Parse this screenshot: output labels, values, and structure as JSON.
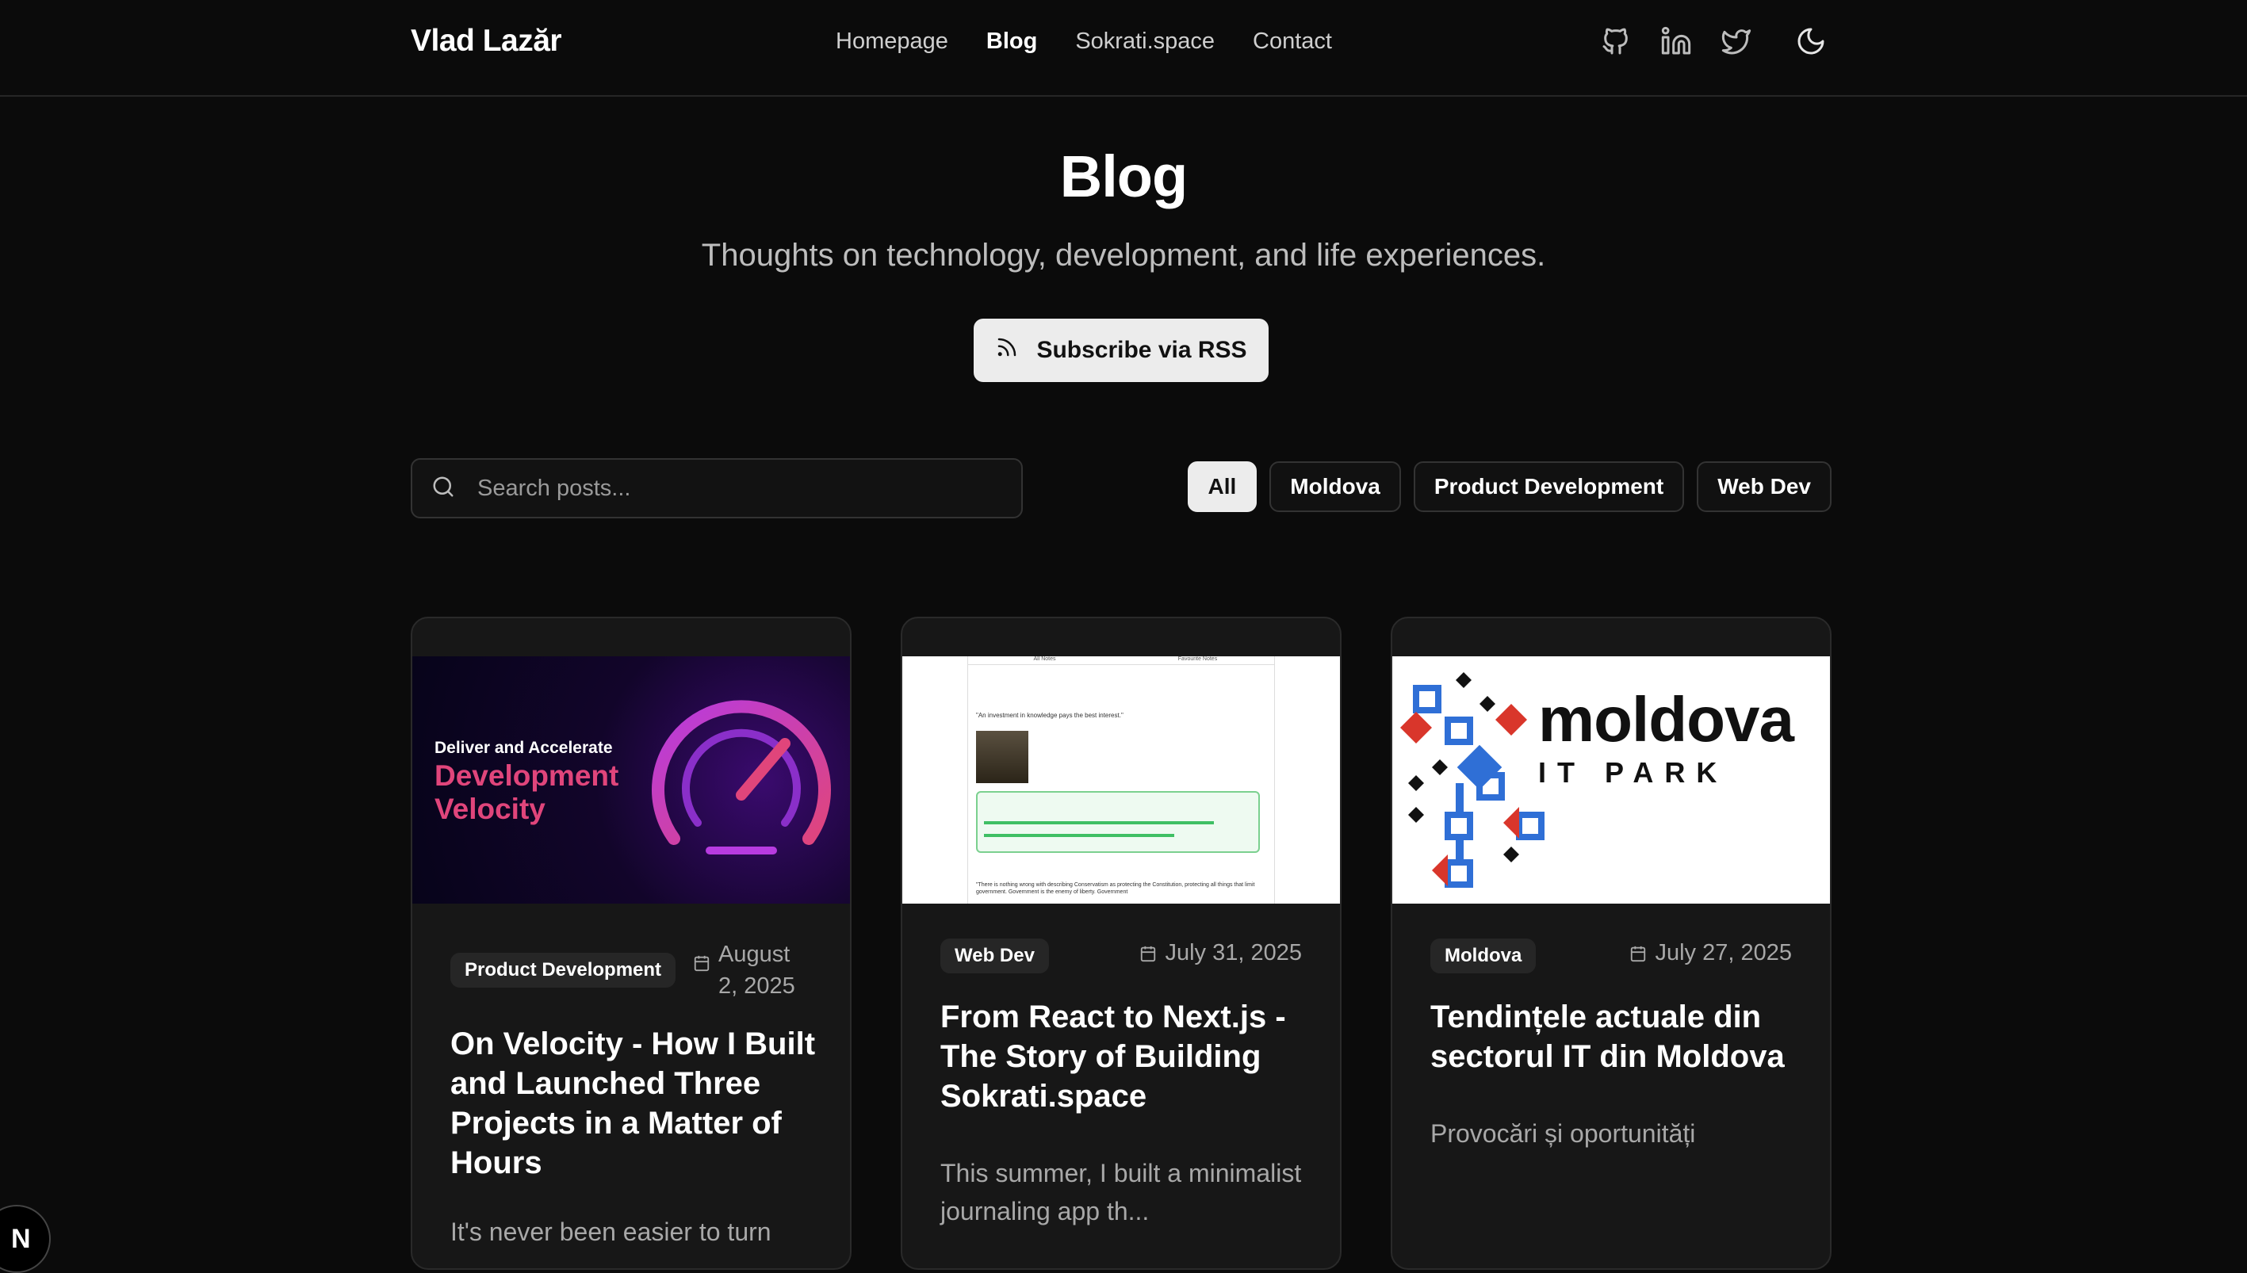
{
  "header": {
    "brand": "Vlad Lazăr",
    "nav": [
      "Homepage",
      "Blog",
      "Sokrati.space",
      "Contact"
    ],
    "active_nav": "Blog",
    "icons": [
      "github-icon",
      "linkedin-icon",
      "twitter-icon",
      "moon-icon"
    ]
  },
  "hero": {
    "title": "Blog",
    "subtitle": "Thoughts on technology, development, and life experiences.",
    "rss_label": "Subscribe via RSS"
  },
  "search": {
    "placeholder": "Search posts..."
  },
  "filters": [
    "All",
    "Moldova",
    "Product Development",
    "Web Dev"
  ],
  "active_filter": "All",
  "posts": [
    {
      "tag": "Product Development",
      "date": "August 2, 2025",
      "title": "On Velocity - How I Built and Launched Three Projects in a Matter of Hours",
      "excerpt": "It's never been easier to turn",
      "thumb": {
        "line1": "Deliver and Accelerate",
        "line2": "Development",
        "line3": "Velocity"
      }
    },
    {
      "tag": "Web Dev",
      "date": "July 31, 2025",
      "title": "From React to Next.js - The Story of Building Sokrati.space",
      "excerpt": "This summer, I built a minimalist journaling app th...",
      "thumb": {
        "tab1": "All Notes",
        "tab2": "Favourite Notes",
        "quote": "\"An investment in knowledge pays the best interest.\"",
        "bottom_quote": "\"There is nothing wrong with describing Conservatism as protecting the Constitution, protecting all things that limit government. Government is the enemy of liberty. Government"
      }
    },
    {
      "tag": "Moldova",
      "date": "July 27, 2025",
      "title": "Tendințele actuale din sectorul IT din Moldova",
      "excerpt": "Provocări și oportunități",
      "thumb": {
        "logo_word": "moldova",
        "logo_sub": "IT PARK"
      }
    }
  ],
  "dev_badge": "N",
  "colors": {
    "background": "#0b0b0b",
    "card": "#171717",
    "accent_pink": "#e0457b",
    "accent_purple": "#9b3be0",
    "moldova_blue": "#2f6fd6",
    "moldova_red": "#d9362b"
  }
}
